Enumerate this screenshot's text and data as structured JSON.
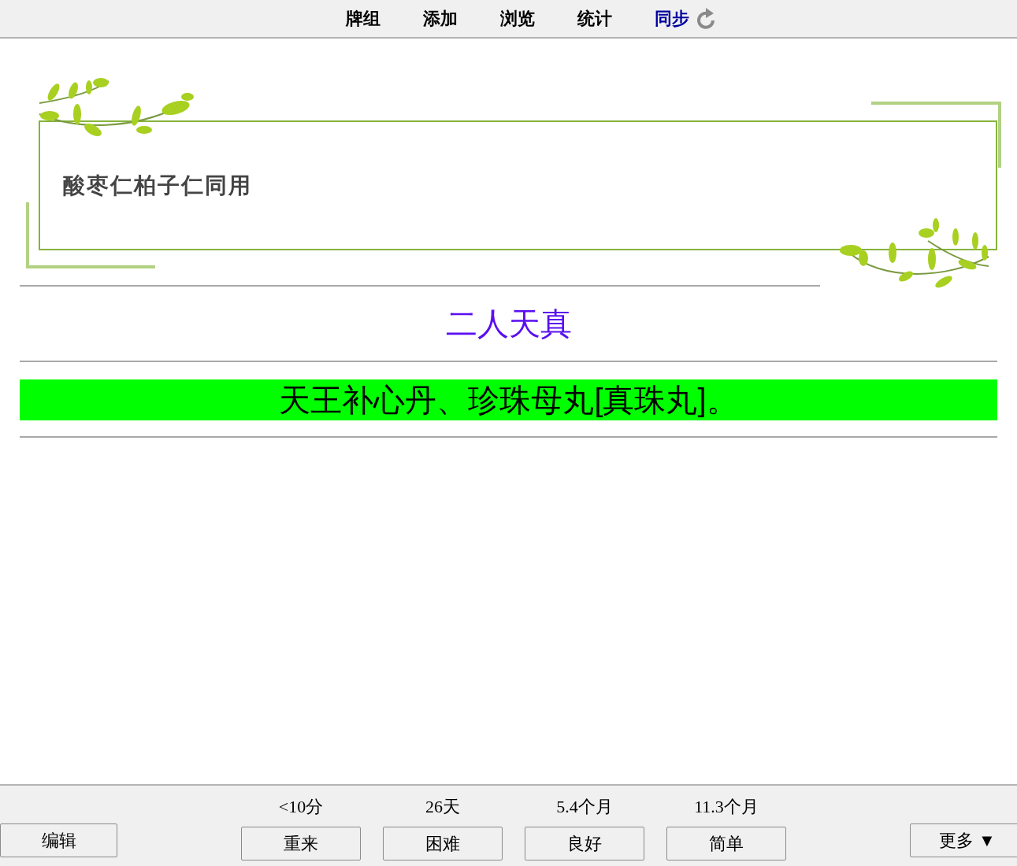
{
  "toolbar": {
    "items": [
      {
        "label": "牌组",
        "kind": "link"
      },
      {
        "label": "添加",
        "kind": "link"
      },
      {
        "label": "浏览",
        "kind": "link"
      },
      {
        "label": "统计",
        "kind": "link"
      },
      {
        "label": "同步",
        "kind": "sync"
      }
    ]
  },
  "card": {
    "front": "酸枣仁柏子仁同用",
    "hint": "二人天真",
    "answer": "天王补心丹、珍珠母丸[真珠丸]。"
  },
  "bottom_bar": {
    "edit_button": "编辑",
    "answer_buttons": [
      {
        "interval": "<10分",
        "label": "重来"
      },
      {
        "interval": "26天",
        "label": "困难"
      },
      {
        "interval": "5.4个月",
        "label": "良好"
      },
      {
        "interval": "11.3个月",
        "label": "简单"
      }
    ],
    "more_button": "更多 ▼"
  }
}
